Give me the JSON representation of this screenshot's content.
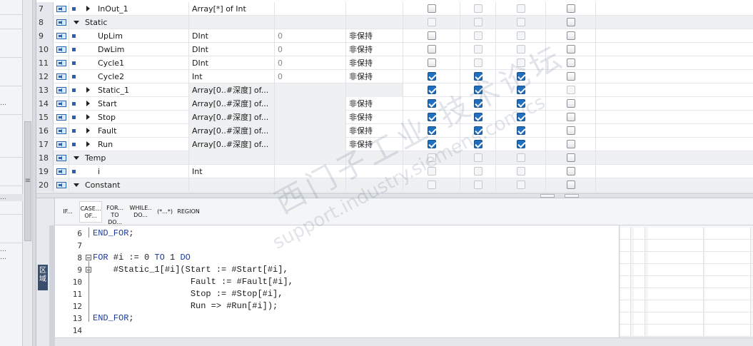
{
  "variable_table": {
    "rows": [
      {
        "no": "7",
        "kind": "member",
        "expand": "right",
        "name": "InOut_1",
        "type": "Array[*] of Int",
        "default": "",
        "retain": "",
        "boxes": [
          "plain",
          "dim",
          "dim",
          "plain"
        ]
      },
      {
        "no": "8",
        "kind": "section",
        "expand": "down",
        "name": "Static",
        "type": "",
        "default": "",
        "retain": "",
        "boxes": [
          "dim",
          "dim",
          "dim",
          "plain"
        ]
      },
      {
        "no": "9",
        "kind": "member",
        "expand": "none",
        "name": "UpLim",
        "type": "DInt",
        "default": "0",
        "retain": "非保持",
        "boxes": [
          "plain",
          "dim",
          "dim",
          "plain"
        ]
      },
      {
        "no": "10",
        "kind": "member",
        "expand": "none",
        "name": "DwLim",
        "type": "DInt",
        "default": "0",
        "retain": "非保持",
        "boxes": [
          "plain",
          "dim",
          "dim",
          "plain"
        ]
      },
      {
        "no": "11",
        "kind": "member",
        "expand": "none",
        "name": "Cycle1",
        "type": "DInt",
        "default": "0",
        "retain": "非保持",
        "boxes": [
          "plain",
          "dim",
          "dim",
          "plain"
        ]
      },
      {
        "no": "12",
        "kind": "member",
        "expand": "none",
        "name": "Cycle2",
        "type": "Int",
        "default": "0",
        "retain": "非保持",
        "boxes": [
          "on",
          "on",
          "on",
          "plain"
        ]
      },
      {
        "no": "13",
        "kind": "member",
        "expand": "right",
        "name": "Static_1",
        "type": "Array[0..#深度] of...",
        "default": "",
        "retain": "",
        "boxes": [
          "on",
          "on",
          "on",
          "dim"
        ]
      },
      {
        "no": "14",
        "kind": "member",
        "expand": "right",
        "name": "Start",
        "type": "Array[0..#深度] of...",
        "default": "",
        "retain": "非保持",
        "boxes": [
          "on",
          "on",
          "on",
          "plain"
        ]
      },
      {
        "no": "15",
        "kind": "member",
        "expand": "right",
        "name": "Stop",
        "type": "Array[0..#深度] of...",
        "default": "",
        "retain": "非保持",
        "boxes": [
          "on",
          "on",
          "on",
          "plain"
        ]
      },
      {
        "no": "16",
        "kind": "member",
        "expand": "right",
        "name": "Fault",
        "type": "Array[0..#深度] of...",
        "default": "",
        "retain": "非保持",
        "boxes": [
          "on",
          "on",
          "on",
          "plain"
        ]
      },
      {
        "no": "17",
        "kind": "member",
        "expand": "right",
        "name": "Run",
        "type": "Array[0..#深度] of...",
        "default": "",
        "retain": "非保持",
        "boxes": [
          "on",
          "on",
          "on",
          "plain"
        ]
      },
      {
        "no": "18",
        "kind": "section",
        "expand": "down",
        "name": "Temp",
        "type": "",
        "default": "",
        "retain": "",
        "boxes": [
          "dim",
          "dim",
          "dim",
          "plain"
        ]
      },
      {
        "no": "19",
        "kind": "member",
        "expand": "none",
        "name": "i",
        "type": "Int",
        "default": "",
        "retain": "",
        "boxes": [
          "dim",
          "dim",
          "dim",
          "plain"
        ]
      },
      {
        "no": "20",
        "kind": "section",
        "expand": "down",
        "name": "Constant",
        "type": "",
        "default": "",
        "retain": "",
        "boxes": [
          "dim",
          "dim",
          "dim",
          "plain"
        ]
      }
    ]
  },
  "toolbar": {
    "buttons": [
      {
        "id": "if",
        "line1": "IF...",
        "line2": ""
      },
      {
        "id": "case",
        "line1": "CASE...",
        "line2": "OF..."
      },
      {
        "id": "for",
        "line1": "FOR...",
        "line2": "TO DO..."
      },
      {
        "id": "while",
        "line1": "WHILE..",
        "line2": "DO..."
      },
      {
        "id": "comment",
        "line1": "(*...*)",
        "line2": ""
      },
      {
        "id": "region",
        "line1": "REGION",
        "line2": ""
      }
    ]
  },
  "side": {
    "region_label": "区域"
  },
  "code_lines": [
    {
      "no": "6",
      "text": "END_FOR;"
    },
    {
      "no": "7",
      "text": ""
    },
    {
      "no": "8",
      "text": "FOR #i := 0 TO 1 DO"
    },
    {
      "no": "9",
      "text": "    #Static_1[#i](Start := #Start[#i],"
    },
    {
      "no": "10",
      "text": "                   Fault := #Fault[#i],"
    },
    {
      "no": "11",
      "text": "                   Stop := #Stop[#i],"
    },
    {
      "no": "12",
      "text": "                   Run => #Run[#i]);"
    },
    {
      "no": "13",
      "text": "END_FOR;"
    },
    {
      "no": "14",
      "text": ""
    }
  ],
  "watermark": {
    "cn": "西门子工业 技术论坛",
    "url": "support.industry.siemens.com/cs"
  },
  "colors": {
    "accent": "#1e6fc0",
    "keyword": "#1a3a9e",
    "row_number_bg": "#e4e7eb"
  }
}
